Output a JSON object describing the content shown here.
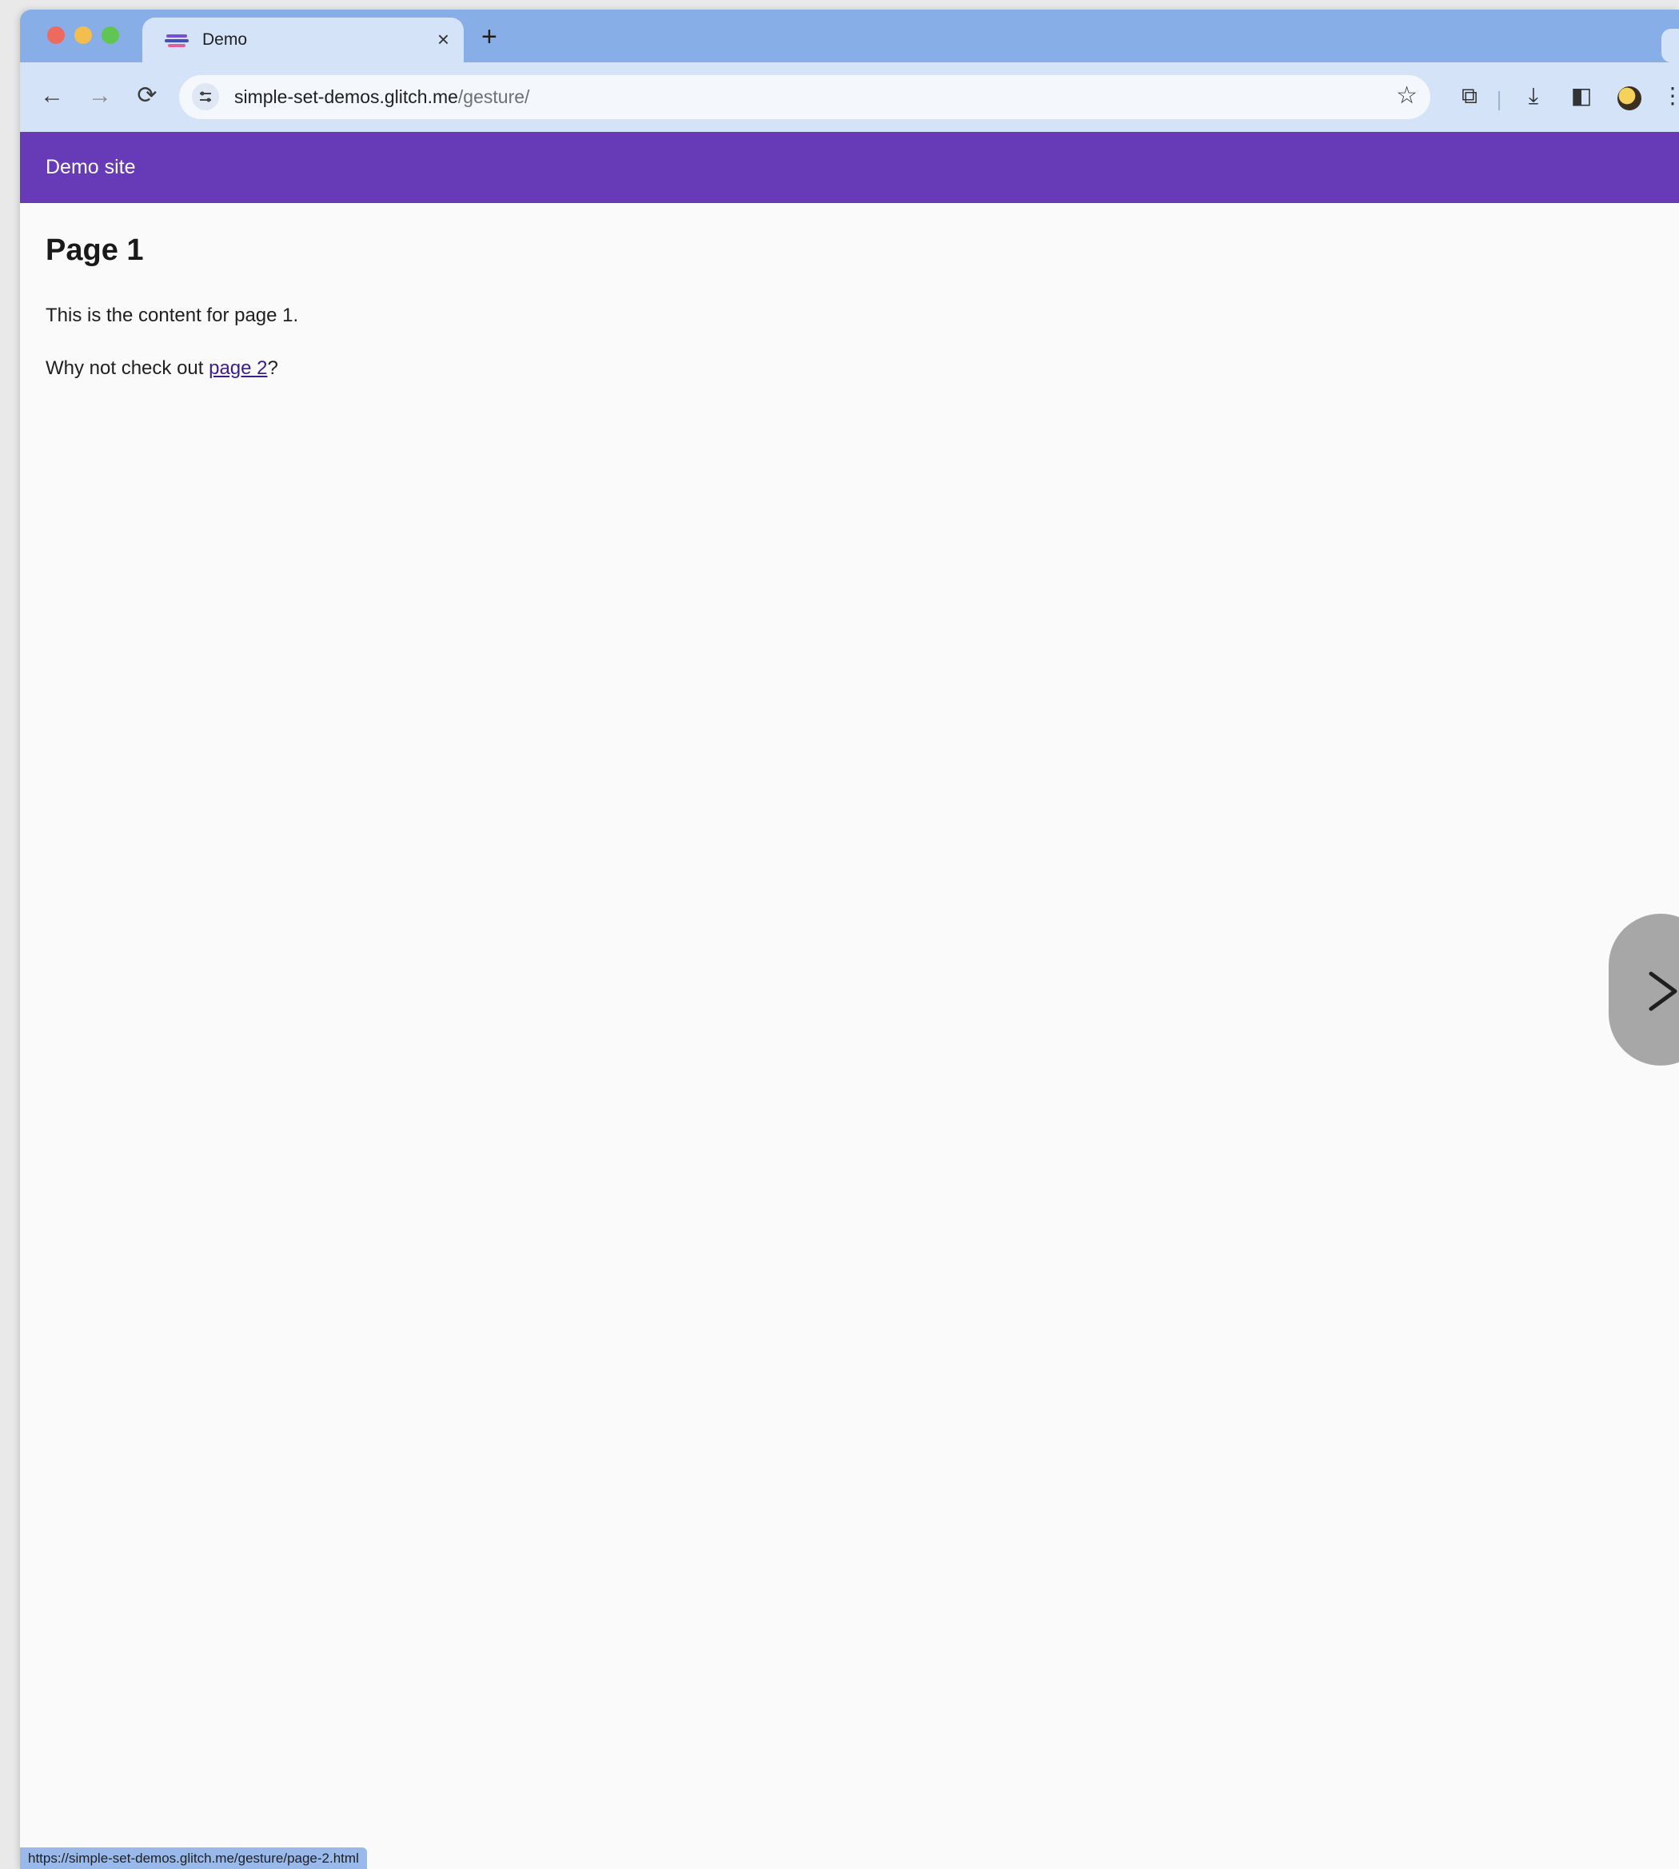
{
  "browser": {
    "tab": {
      "title": "Demo",
      "close_glyph": "×",
      "favicon": "demo-favicon-icon"
    },
    "new_tab_glyph": "+",
    "toolbar": {
      "back_glyph": "←",
      "forward_glyph": "→",
      "reload_glyph": "⟳",
      "url_host": "simple-set-demos.glitch.me",
      "url_path": "/gesture/",
      "bookmark_glyph": "☆",
      "extensions_glyph": "⧉",
      "download_glyph": "⤓",
      "sidepanel_glyph": "◧",
      "menu_glyph": "⋮"
    },
    "status_url": "https://simple-set-demos.glitch.me/gesture/page-2.html"
  },
  "site": {
    "header_title": "Demo site",
    "heading": "Page 1",
    "paragraph1": "This is the content for page 1.",
    "paragraph2_prefix": "Why not check out ",
    "link_text": "page 2",
    "paragraph2_suffix": "?"
  },
  "colors": {
    "tab_strip": "#88aee8",
    "toolbar": "#d5e3f9",
    "site_header": "#673ab7",
    "link": "#3b1d8f",
    "gesture_indicator": "#a7a7a7"
  },
  "icons": {
    "gesture": "back-forward-arrow-icon"
  }
}
